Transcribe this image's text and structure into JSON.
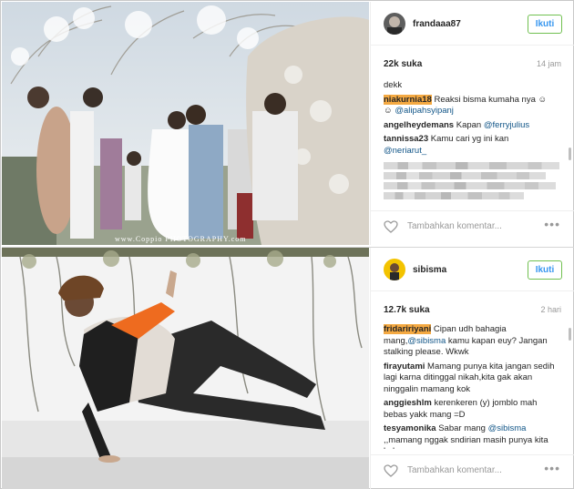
{
  "post1": {
    "username": "frandaaa87",
    "follow_label": "Ikuti",
    "likes": "22k suka",
    "age": "14 jam",
    "watermark": "www.Coppio PHOTOGRAPHY.com",
    "caption": "dekk",
    "comments": [
      {
        "user": "niakurnia18",
        "text": "Reaksi bisma kumaha nya",
        "extra": "@alipahsyipanj",
        "highlighted": true
      },
      {
        "user": "angelheydemans",
        "text": "Kapan",
        "mention": "@ferryjulius"
      },
      {
        "user": "tannissa23",
        "text": "Kamu cari yg ini kan",
        "mention": "@neriarut_"
      }
    ],
    "add_comment_placeholder": "Tambahkan komentar...",
    "more_label": "•••"
  },
  "post2": {
    "username": "sibisma",
    "follow_label": "Ikuti",
    "likes": "12.7k suka",
    "age": "2 hari",
    "comments": [
      {
        "user": "fridaririyani",
        "text_pre": "Cipan udh bahagia mang,",
        "mention": "@sibisma",
        "text_post": "kamu kapan euy? Jangan stalking please. Wkwk",
        "highlighted": true
      },
      {
        "user": "firayutami",
        "text": "Mamang punya kita jangan sedih lagi karna ditinggal nikah,kita gak akan ninggalin mamang kok"
      },
      {
        "user": "anggieshlm",
        "text": "kerenkeren (y) jomblo mah bebas yakk mang =D"
      },
      {
        "user": "tesyamonika",
        "text_pre": "Sabar mang",
        "mention": "@sibisma",
        "text_post": ",,mamang nggak sndirian masih punya kita kok"
      }
    ],
    "add_comment_placeholder": "Tambahkan komentar...",
    "more_label": "•••"
  },
  "colors": {
    "link": "#125688",
    "follow_text": "#3897f0",
    "follow_border": "#70c050",
    "highlight": "#f4a942"
  }
}
